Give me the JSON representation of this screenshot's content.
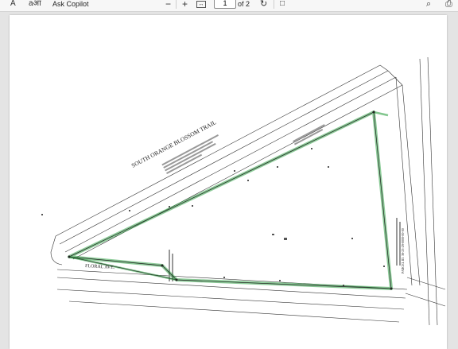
{
  "toolbar": {
    "read_aloud_icon": "À",
    "translate_icon": "aआ",
    "ask_copilot": "Ask Copilot",
    "zoom_out": "−",
    "zoom_in": "+",
    "fit_icon": "↔",
    "page_current": "1",
    "page_total": "of 2",
    "rotate_icon": "↻",
    "view_icon": "□",
    "search_icon": "⌕",
    "print_icon": "⎙"
  },
  "document": {
    "road_label_1": "SOUTH ORANGE BLOSSOM TRAIL",
    "road_label_2": "FLORAL AVE.",
    "parcel_label": "PARCEL ID. 36-23-29-0000-00-00"
  },
  "colors": {
    "boundary": "#2ea043",
    "linework": "#333333",
    "page_bg": "#ffffff",
    "viewer_bg": "#e4e4e4"
  }
}
